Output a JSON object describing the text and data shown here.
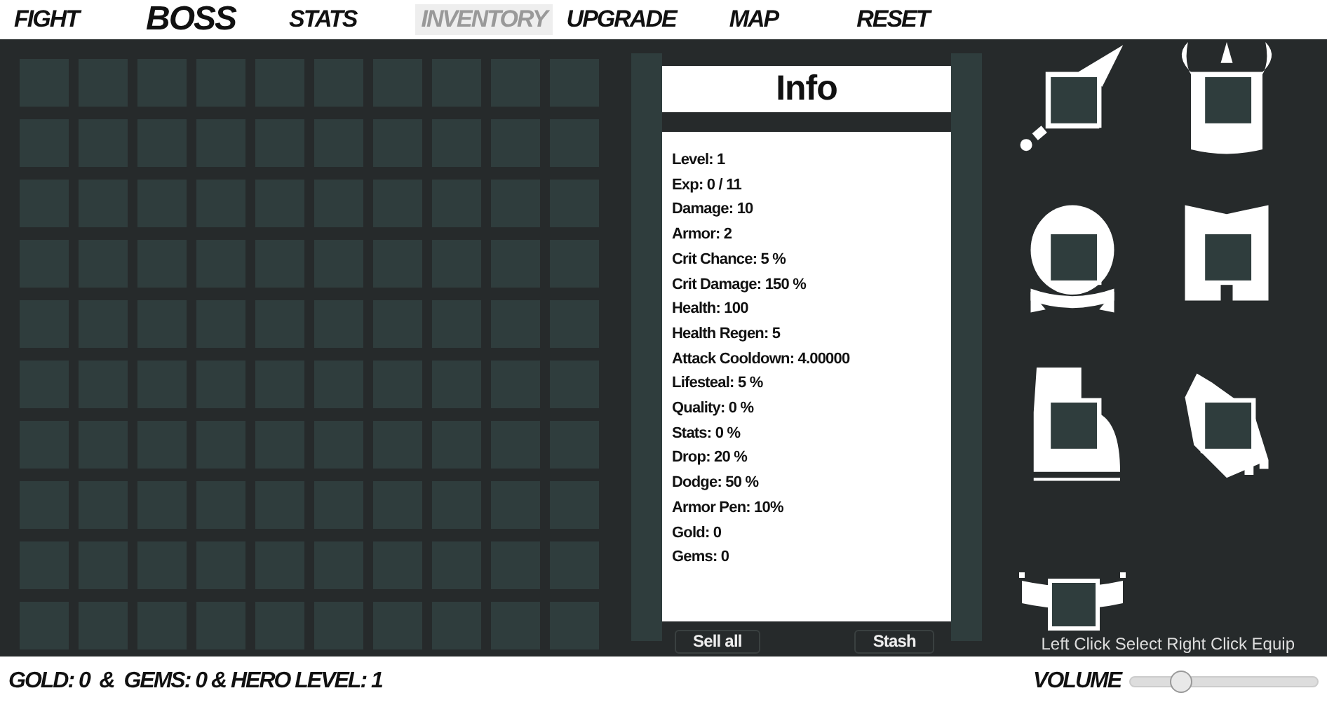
{
  "nav": [
    {
      "label": "FIGHT",
      "kind": "normal",
      "selected": false
    },
    {
      "label": "BOSS",
      "kind": "large",
      "selected": false
    },
    {
      "label": "STATS",
      "kind": "normal",
      "selected": false
    },
    {
      "label": "INVENTORY",
      "kind": "normal",
      "selected": true
    },
    {
      "label": "UPGRADE",
      "kind": "normal",
      "selected": false
    },
    {
      "label": "MAP",
      "kind": "normal",
      "selected": false
    },
    {
      "label": "RESET",
      "kind": "normal",
      "selected": false
    }
  ],
  "info": {
    "title": "Info",
    "stats": [
      "Level: 1",
      "Exp: 0 / 11",
      "Damage: 10",
      "Armor: 2",
      "Crit Chance: 5 %",
      "Crit Damage: 150 %",
      "Health: 100",
      "Health Regen: 5",
      "Attack Cooldown: 4.00000",
      "Lifesteal: 5 %",
      "Quality: 0 %",
      "Stats: 0 %",
      "Drop: 20 %",
      "Dodge: 50 %",
      "Armor Pen: 10%",
      "Gold: 0",
      "Gems: 0"
    ],
    "buttons": [
      "Sell all",
      "Stash"
    ]
  },
  "equipment": [
    {
      "kind": "sword"
    },
    {
      "kind": "helmet"
    },
    {
      "kind": "chest"
    },
    {
      "kind": "legs"
    },
    {
      "kind": "boots"
    },
    {
      "kind": "gloves"
    },
    {
      "kind": "belt"
    }
  ],
  "hint": "Left Click Select Right Click Equip",
  "footer": {
    "status": "GOLD: 0  &  GEMS: 0 & HERO LEVEL: 1",
    "volume_label": "VOLUME",
    "volume": {
      "level": 0.27
    }
  }
}
